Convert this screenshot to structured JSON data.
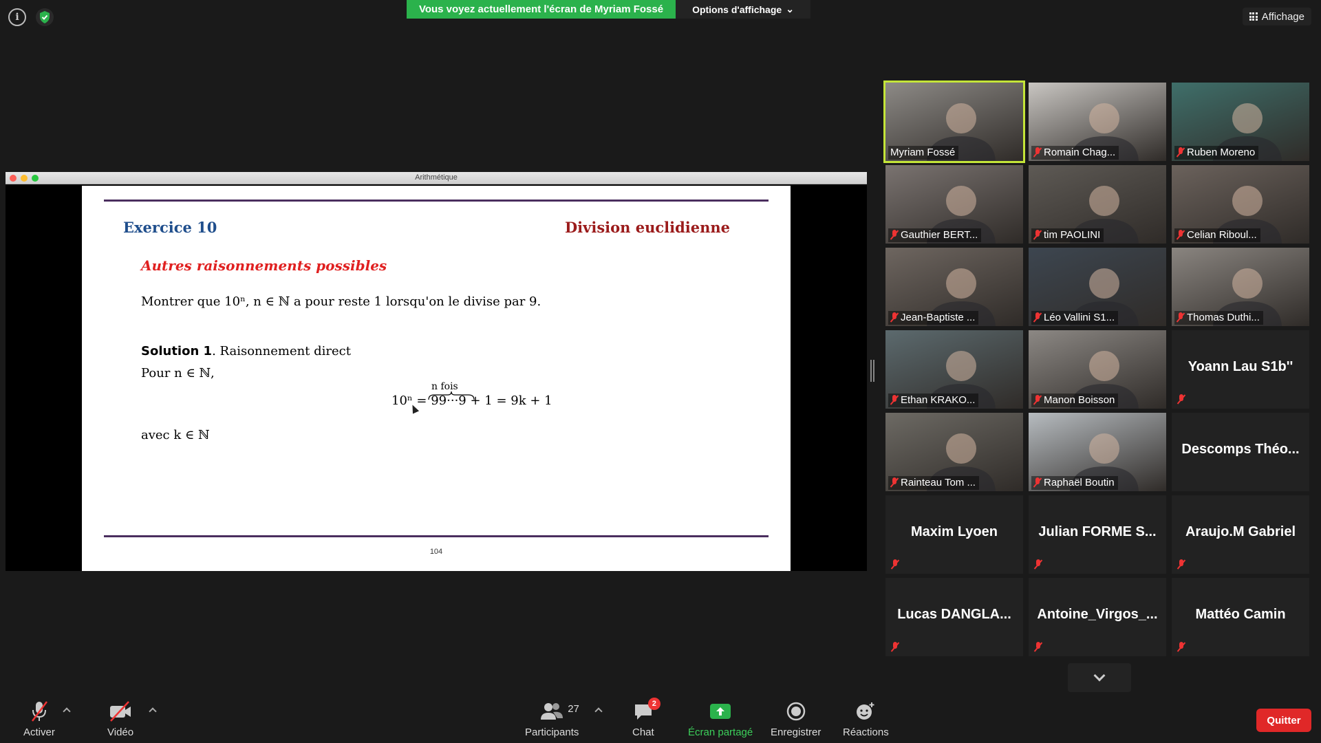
{
  "share_banner": "Vous voyez actuellement l'écran de Myriam Fossé",
  "view_options": "Options d'affichage",
  "view_button": "Affichage",
  "window_title": "Arithmétique",
  "slide": {
    "exercise": "Exercice 10",
    "topic": "Division euclidienne",
    "subtitle": "Autres raisonnements possibles",
    "statement": "Montrer que 10ⁿ, n ∈ ℕ a pour reste 1 lorsqu'on le divise par 9.",
    "solution_label": "Solution 1",
    "solution_text": ". Raisonnement direct",
    "for_n": "Pour n ∈ ℕ,",
    "brace_label": "n fois",
    "formula": "10ⁿ = 99···9 + 1 = 9k + 1",
    "with_k": "avec k ∈ ℕ",
    "page_number": "104"
  },
  "participants": [
    {
      "name": "Myriam Fossé",
      "video": true,
      "active": true,
      "muted": false,
      "bg": "#8d8a86"
    },
    {
      "name": "Romain Chag...",
      "video": true,
      "muted": true,
      "bg": "#c9c6c2"
    },
    {
      "name": "Ruben Moreno",
      "video": true,
      "muted": true,
      "bg": "#3f6f6a"
    },
    {
      "name": "Gauthier BERT...",
      "video": true,
      "muted": true,
      "bg": "#7a7370"
    },
    {
      "name": "tim PAOLINI",
      "video": true,
      "muted": true,
      "bg": "#5e5a55"
    },
    {
      "name": "Celian Riboul...",
      "video": true,
      "muted": true,
      "bg": "#6b625c"
    },
    {
      "name": "Jean-Baptiste ...",
      "video": true,
      "muted": true,
      "bg": "#6e6660"
    },
    {
      "name": "Léo Vallini S1...",
      "video": true,
      "muted": true,
      "bg": "#3d4650"
    },
    {
      "name": "Thomas Duthi...",
      "video": true,
      "muted": true,
      "bg": "#8a8580"
    },
    {
      "name": "Ethan KRAKO...",
      "video": true,
      "muted": true,
      "bg": "#5c6a6e"
    },
    {
      "name": "Manon Boisson",
      "video": true,
      "muted": true,
      "bg": "#8c8884"
    },
    {
      "name": "Yoann Lau S1b''",
      "video": false,
      "muted": true
    },
    {
      "name": "Rainteau Tom ...",
      "video": true,
      "muted": true,
      "bg": "#6d6a64"
    },
    {
      "name": "Raphaël Boutin",
      "video": true,
      "muted": true,
      "bg": "#b7bcc0"
    },
    {
      "name": "Descomps Théo...",
      "video": false,
      "muted": false
    },
    {
      "name": "Maxim Lyoen",
      "video": false,
      "muted": true
    },
    {
      "name": "Julian FORME S...",
      "video": false,
      "muted": true
    },
    {
      "name": "Araujo.M Gabriel",
      "video": false,
      "muted": true
    },
    {
      "name": "Lucas DANGLA...",
      "video": false,
      "muted": true
    },
    {
      "name": "Antoine_Virgos_...",
      "video": false,
      "muted": true
    },
    {
      "name": "Mattéo Camin",
      "video": false,
      "muted": true
    }
  ],
  "toolbar": {
    "unmute": "Activer",
    "video": "Vidéo",
    "participants": "Participants",
    "participants_count": "27",
    "chat": "Chat",
    "chat_badge": "2",
    "share": "Écran partagé",
    "record": "Enregistrer",
    "reactions": "Réactions",
    "quit": "Quitter"
  },
  "colors": {
    "share_green": "#2bb24c",
    "active_speaker": "#c4e538",
    "quit_red": "#e02828",
    "exercise_blue": "#1f4e8c",
    "topic_red": "#9b1b1b"
  }
}
